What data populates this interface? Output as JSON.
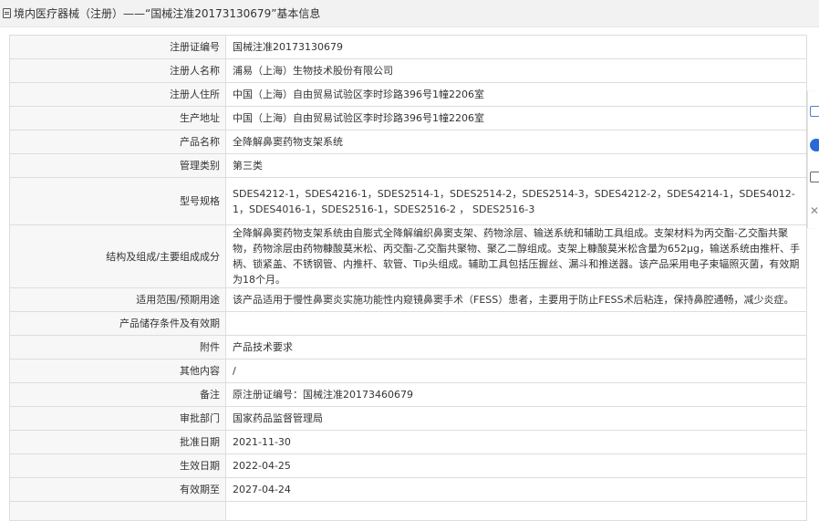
{
  "header": {
    "title": "境内医疗器械（注册）——“国械注准20173130679”基本信息"
  },
  "rows": [
    {
      "label": "注册证编号",
      "value": "国械注准20173130679"
    },
    {
      "label": "注册人名称",
      "value": "浦易（上海）生物技术股份有限公司"
    },
    {
      "label": "注册人住所",
      "value": "中国（上海）自由贸易试验区李时珍路396号1幢2206室"
    },
    {
      "label": "生产地址",
      "value": "中国（上海）自由贸易试验区李时珍路396号1幢2206室"
    },
    {
      "label": "产品名称",
      "value": "全降解鼻窦药物支架系统"
    },
    {
      "label": "管理类别",
      "value": "第三类"
    },
    {
      "label": "型号规格",
      "value": "SDES4212-1，SDES4216-1，SDES2514-1，SDES2514-2，SDES2514-3，SDES4212-2，SDES4214-1，SDES4012-1，SDES4016-1，SDES2516-1，SDES2516-2 ， SDES2516-3"
    },
    {
      "label": "结构及组成/主要组成成分",
      "value": "全降解鼻窦药物支架系统由自膨式全降解编织鼻窦支架、药物涂层、输送系统和辅助工具组成。支架材料为丙交酯-乙交酯共聚物，药物涂层由药物糠酸莫米松、丙交酯-乙交酯共聚物、聚乙二醇组成。支架上糠酸莫米松含量为652μg，输送系统由推杆、手柄、锁紧盖、不锈钢管、内推杆、软管、Tip头组成。辅助工具包括压握丝、漏斗和推送器。该产品采用电子束辐照灭菌，有效期为18个月。"
    },
    {
      "label": "适用范围/预期用途",
      "value": "该产品适用于慢性鼻窦炎实施功能性内窥镜鼻窦手术（FESS）患者，主要用于防止FESS术后粘连，保持鼻腔通畅，减少炎症。"
    },
    {
      "label": "产品储存条件及有效期",
      "value": ""
    },
    {
      "label": "附件",
      "value": "产品技术要求"
    },
    {
      "label": "其他内容",
      "value": "/"
    },
    {
      "label": "备注",
      "value": "原注册证编号：国械注准20173460679"
    },
    {
      "label": "审批部门",
      "value": "国家药品监督管理局"
    },
    {
      "label": "批准日期",
      "value": "2021-11-30"
    },
    {
      "label": "生效日期",
      "value": "2022-04-25"
    },
    {
      "label": "有效期至",
      "value": "2027-04-24"
    },
    {
      "label": "",
      "value": ""
    }
  ],
  "toolbar": {
    "icons": [
      "document-icon",
      "info-circle-icon",
      "copy-icon",
      "close-icon"
    ]
  },
  "colors": {
    "header_bg": "#f2f2f2",
    "label_bg": "#f7f7f7",
    "border": "#dddddd",
    "accent": "#2a6ad8"
  }
}
